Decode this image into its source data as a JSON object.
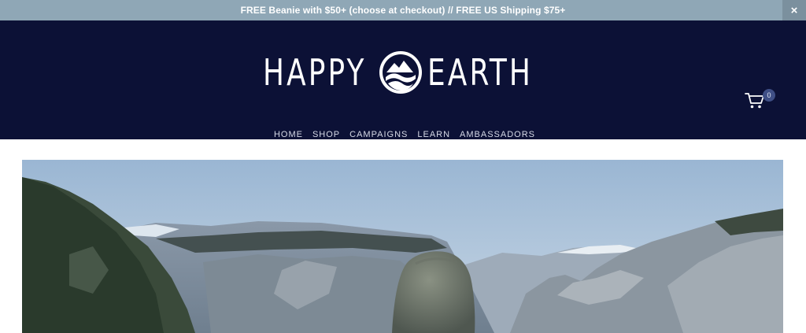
{
  "announcement": {
    "text": "FREE Beanie with $50+ (choose at checkout) // FREE US Shipping $75+",
    "close_glyph": "×"
  },
  "header": {
    "logo": {
      "left_word": "HAPPY",
      "right_word": "EARTH",
      "badge_icon": "wave-mountain-emblem-icon"
    },
    "nav": [
      "HOME",
      "SHOP",
      "CAMPAIGNS",
      "LEARN",
      "AMBASSADORS"
    ],
    "cart": {
      "icon": "shopping-cart-icon",
      "count": "0"
    }
  },
  "hero": {
    "image": "person-in-beanie-facing-mountain-valley"
  },
  "colors": {
    "announcement_bg": "#8fa7b6",
    "header_bg": "#0c1136",
    "nav_text": "#d5d9e6",
    "cart_badge": "#3f4f86"
  }
}
